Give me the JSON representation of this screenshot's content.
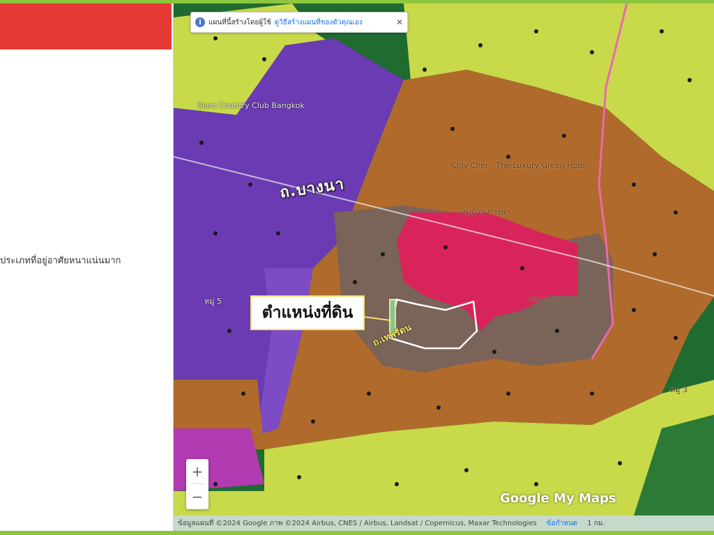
{
  "legend_panel": {
    "header_color": "#e53935",
    "zone_text": "ประเภทที่อยู่อาศัยหนาแน่นมาก"
  },
  "map": {
    "info_bar": {
      "message": "แผนที่นี้สร้างโดยผู้ใช้",
      "link": "ดูวิธีสร้างแผนที่ของตัวคุณเอง",
      "close_icon": "close-icon"
    },
    "zoom": {
      "in": "+",
      "out": "−"
    },
    "callout_label": "ตำแหน่งที่ดิน",
    "road_label": "ถ.บางนา",
    "road_label_small": "ถ.เทพรัตน",
    "places": [
      "Siam Country Club Bangkok",
      "Chiv Cher - The Luxury Green Hotel",
      "หมู่บ้าน บางนา",
      "วัดบางบ่อ",
      "หมู่ 5",
      "หมู่ 3"
    ],
    "logo": "Google My Maps",
    "attribution": "ข้อมูลแผนที่ ©2024 Google ภาพ ©2024 Airbus, CNES / Airbus, Landsat / Copernicus, Maxar Technologies",
    "terms_link": "ข้อกำหนด",
    "scale_text": "1 กม.",
    "zone_colors": {
      "agricultural": "#c8d94a",
      "rural_agri": "#b06a2c",
      "industrial": "#6a3bb3",
      "commercial": "#d8245a",
      "community": "#7a6358",
      "forest": "#1f6b30"
    }
  }
}
